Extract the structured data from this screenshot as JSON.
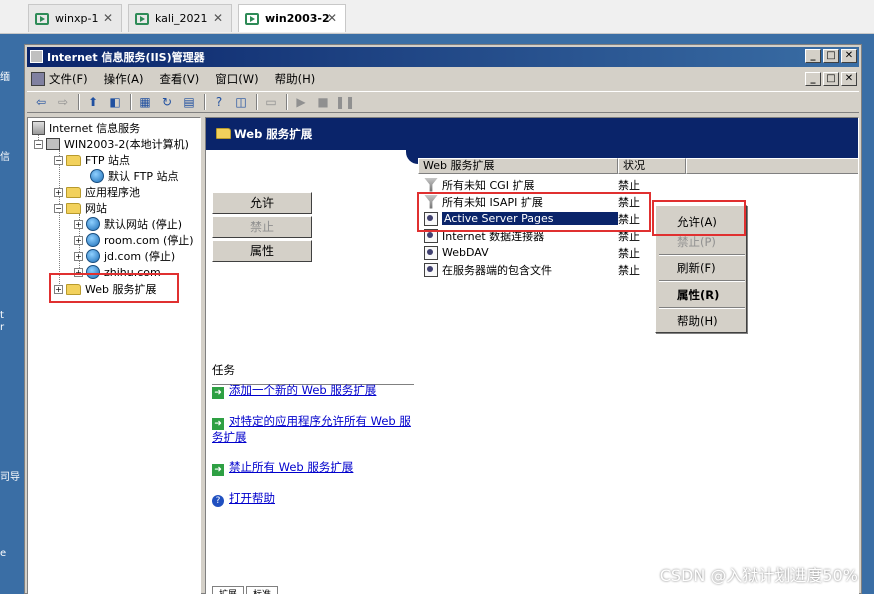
{
  "host_tabs": [
    {
      "label": "winxp-1",
      "active": false
    },
    {
      "label": "kali_2021",
      "active": false
    },
    {
      "label": "win2003-2",
      "active": true
    }
  ],
  "desktop_edge": [
    "缅",
    "信",
    "t",
    "r",
    "司导",
    "e"
  ],
  "window": {
    "title": "Internet 信息服务(IIS)管理器",
    "buttons": [
      "_",
      "□",
      "✕"
    ]
  },
  "menubar": {
    "items": [
      "文件(F)",
      "操作(A)",
      "查看(V)",
      "窗口(W)",
      "帮助(H)"
    ]
  },
  "tree": {
    "root": "Internet 信息服务",
    "computer": "WIN2003-2(本地计算机)",
    "ftp_sites": "FTP 站点",
    "default_ftp": "默认 FTP 站点",
    "app_pools": "应用程序池",
    "websites": "网站",
    "default_site": "默认网站 (停止)",
    "room": "room.com (停止)",
    "jd": "jd.com (停止)",
    "zhihu": "zhihu.com",
    "web_ext": "Web 服务扩展"
  },
  "content": {
    "header": "Web 服务扩展",
    "buttons": {
      "allow": "允许",
      "deny": "禁止",
      "properties": "属性"
    },
    "tasks_label": "任务",
    "tasks": [
      "添加一个新的 Web 服务扩展",
      "对特定的应用程序允许所有 Web 服务扩展",
      "禁止所有 Web 服务扩展",
      "打开帮助"
    ]
  },
  "list": {
    "columns": [
      "Web 服务扩展",
      "状况"
    ],
    "rows": [
      {
        "name": "所有未知 CGI 扩展",
        "status": "禁止",
        "icon": "filter-icon"
      },
      {
        "name": "所有未知 ISAPI 扩展",
        "status": "禁止",
        "icon": "filter-icon"
      },
      {
        "name": "Active Server Pages",
        "status": "禁止",
        "icon": "extension-icon"
      },
      {
        "name": "Internet 数据连接器",
        "status": "禁止",
        "icon": "extension-icon"
      },
      {
        "name": "WebDAV",
        "status": "禁止",
        "icon": "extension-icon"
      },
      {
        "name": "在服务器端的包含文件",
        "status": "禁止",
        "icon": "extension-icon"
      }
    ]
  },
  "context_menu": {
    "allow": "允许(A)",
    "deny": "禁止(P)",
    "refresh": "刷新(F)",
    "properties": "属性(R)",
    "help": "帮助(H)"
  },
  "bottom_tabs": [
    "扩展",
    "标准"
  ],
  "watermark": "CSDN @入狱计划进度50%",
  "colors": {
    "selection": "#0a246a",
    "highlight_box": "#e03030",
    "desktop": "#3a6ea5"
  }
}
